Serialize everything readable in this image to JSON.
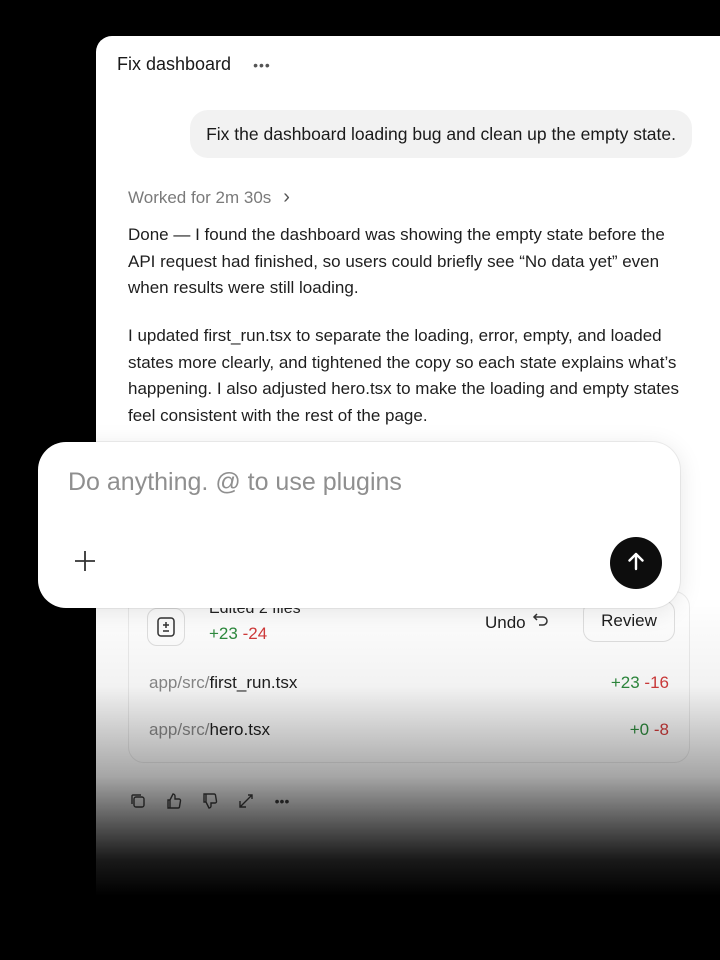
{
  "header": {
    "title": "Fix dashboard",
    "more_icon": "more-horizontal-icon"
  },
  "user_message": "Fix the dashboard loading bug and clean up the empty state.",
  "worked": {
    "label": "Worked for 2m 30s",
    "chevron": "›"
  },
  "response": {
    "paragraph1": "Done — I found the dashboard was showing the empty state before the API request had finished, so users could briefly see “No data yet” even when results were still loading.",
    "paragraph2": "I updated first_run.tsx to separate the loading, error, empty, and loaded states more clearly, and tightened the copy so each state explains what’s happening. I also adjusted hero.tsx to make the loading and empty states feel consistent with the rest of the page."
  },
  "edits": {
    "title": "Edited 2 files",
    "additions": "+23",
    "deletions": "-24",
    "undo_label": "Undo",
    "review_label": "Review",
    "files": [
      {
        "dir": "app/src/",
        "name": "first_run.tsx",
        "additions": "+23",
        "deletions": "-16"
      },
      {
        "dir": "app/src/",
        "name": "hero.tsx",
        "additions": "+0",
        "deletions": "-8"
      }
    ]
  },
  "actions": [
    "copy-icon",
    "thumbs-up-icon",
    "thumbs-down-icon",
    "share-icon",
    "more-horizontal-icon"
  ],
  "composer": {
    "placeholder": "Do anything. @ to use plugins"
  },
  "colors": {
    "additions": "#2e8b3e",
    "deletions": "#d23b3b",
    "send_button": "#0d0d0d",
    "background": "#000000"
  }
}
